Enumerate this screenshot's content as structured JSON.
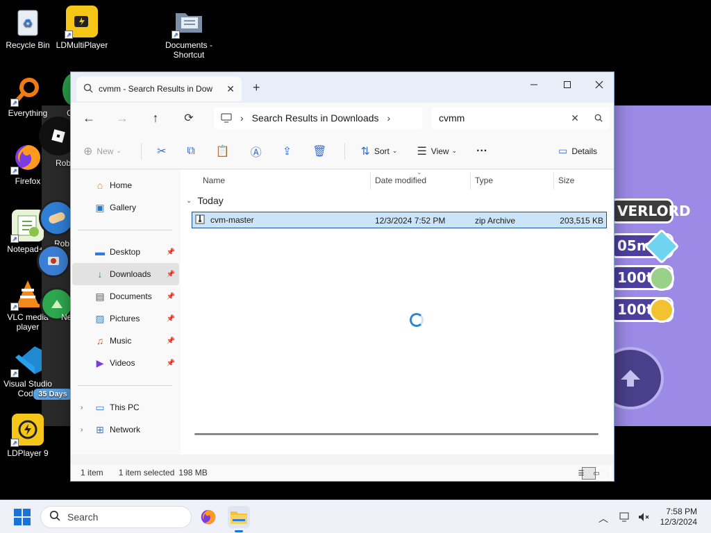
{
  "desktop": {
    "icons": [
      {
        "label": "Recycle Bin"
      },
      {
        "label": "LDMultiPlayer"
      },
      {
        "label": "Documents - Shortcut"
      },
      {
        "label": "Everything"
      },
      {
        "label": "Firefox"
      },
      {
        "label": "Notepad++"
      },
      {
        "label": "VLC media player"
      },
      {
        "label": "Visual Studio Code"
      },
      {
        "label": "LDPlayer 9"
      }
    ],
    "partial_labels": {
      "c": "C",
      "rob1": "Rob",
      "rob2": "Rob",
      "ne": "Ne",
      "days": "35 Days"
    },
    "game": {
      "overlord": "VERLORD",
      "gems": "05m",
      "coins1": "100t",
      "coins2": "100t"
    }
  },
  "window": {
    "tab_title": "cvmm - Search Results in Dow",
    "new_tab": "+",
    "breadcrumb": "Search Results in Downloads",
    "search_value": "cvmm",
    "commands": {
      "new": "New",
      "sort": "Sort",
      "view": "View",
      "more": "···",
      "details": "Details"
    },
    "sidebar": {
      "home": "Home",
      "gallery": "Gallery",
      "desktop": "Desktop",
      "downloads": "Downloads",
      "documents": "Documents",
      "pictures": "Pictures",
      "music": "Music",
      "videos": "Videos",
      "this_pc": "This PC",
      "network": "Network"
    },
    "columns": {
      "name": "Name",
      "date": "Date modified",
      "type": "Type",
      "size": "Size"
    },
    "group": "Today",
    "files": [
      {
        "name": "cvm-master",
        "date": "12/3/2024 7:52 PM",
        "type": "zip Archive",
        "size": "203,515 KB"
      }
    ],
    "status": {
      "count": "1 item",
      "selected": "1 item selected",
      "size": "198 MB"
    }
  },
  "taskbar": {
    "search_placeholder": "Search",
    "time": "7:58 PM",
    "date": "12/3/2024"
  },
  "colors": {
    "accent": "#1a73d8",
    "selection": "#cce4f7",
    "game_bg": "#9b8ae6"
  }
}
